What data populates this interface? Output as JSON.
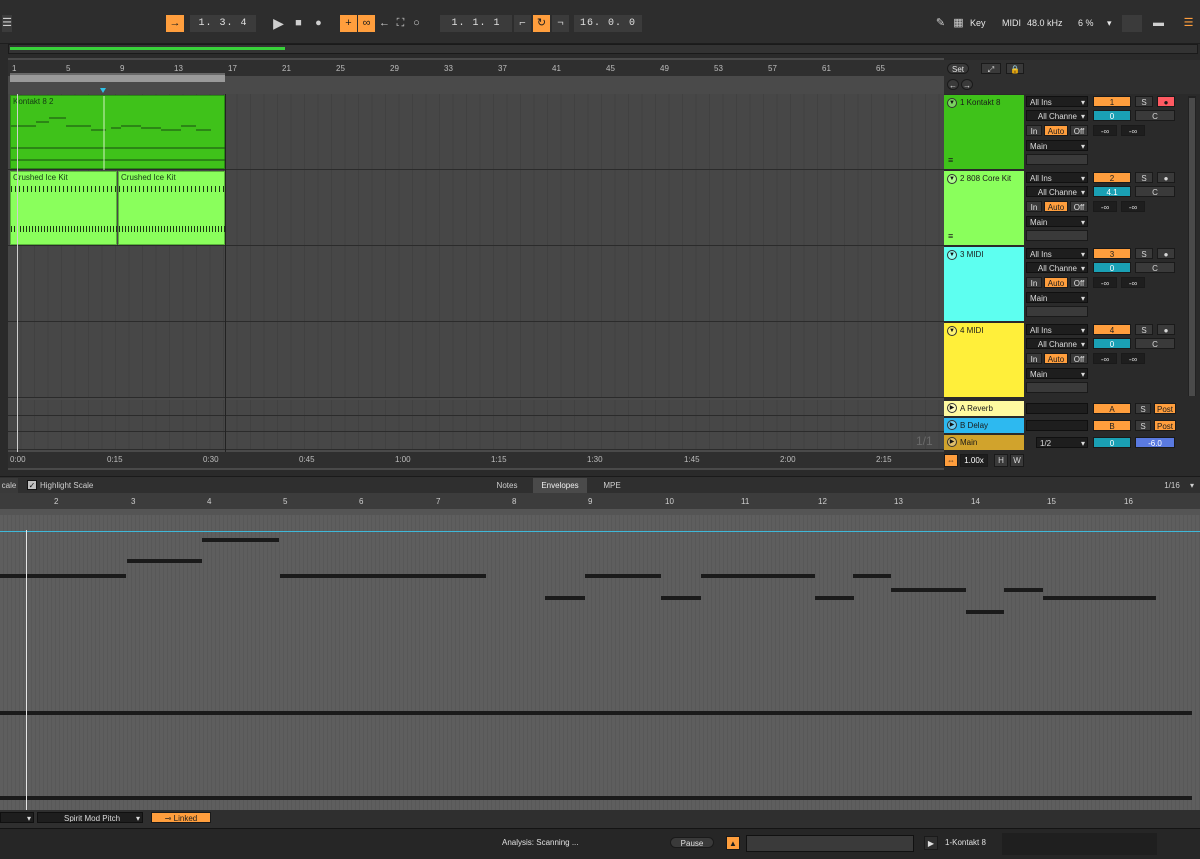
{
  "transport": {
    "arrangement_position": "1.  3.  4",
    "loop_start": "1.  1.  1",
    "loop_length": "16.  0.  0"
  },
  "topbar_right": {
    "key_label": "Key",
    "midi_label": "MIDI",
    "sample_rate": "48.0 kHz",
    "cpu_load": "6 %"
  },
  "ruler": {
    "bars": [
      "1",
      "5",
      "9",
      "13",
      "17",
      "21",
      "25",
      "29",
      "33",
      "37",
      "41",
      "45",
      "49",
      "53",
      "57",
      "61",
      "65"
    ]
  },
  "timeline": {
    "times": [
      "0:00",
      "0:15",
      "0:30",
      "0:45",
      "1:00",
      "1:15",
      "1:30",
      "1:45",
      "2:00",
      "2:15"
    ]
  },
  "clips": {
    "kontakt_clip": "Kontakt 8 2",
    "drum_clip_1": "Crushed Ice Kit",
    "drum_clip_2": "Crushed Ice Kit"
  },
  "set_button": "Set",
  "tracks": [
    {
      "name": "1 Kontakt 8",
      "color": "#3fc21a",
      "number": "1",
      "input": "All Ins",
      "channel": "All Channe",
      "monitor": [
        "In",
        "Auto",
        "Off"
      ],
      "output": "Main",
      "volume": "0",
      "pan": "C",
      "sends": [
        "-∞",
        "-∞"
      ],
      "solo": "S"
    },
    {
      "name": "2 808 Core Kit",
      "color": "#8aff5c",
      "number": "2",
      "input": "All Ins",
      "channel": "All Channe",
      "monitor": [
        "In",
        "Auto",
        "Off"
      ],
      "output": "Main",
      "volume": "4.1",
      "pan": "C",
      "sends": [
        "-∞",
        "-∞"
      ],
      "solo": "S"
    },
    {
      "name": "3 MIDI",
      "color": "#5dfff0",
      "number": "3",
      "input": "All Ins",
      "channel": "All Channe",
      "monitor": [
        "In",
        "Auto",
        "Off"
      ],
      "output": "Main",
      "volume": "0",
      "pan": "C",
      "sends": [
        "-∞",
        "-∞"
      ],
      "solo": "S"
    },
    {
      "name": "4 MIDI",
      "color": "#ffef3a",
      "number": "4",
      "input": "All Ins",
      "channel": "All Channe",
      "monitor": [
        "In",
        "Auto",
        "Off"
      ],
      "output": "Main",
      "volume": "0",
      "pan": "C",
      "sends": [
        "-∞",
        "-∞"
      ],
      "solo": "S"
    }
  ],
  "returns": [
    {
      "name": "A Reverb",
      "color": "#fffaa0",
      "letter": "A",
      "solo": "S",
      "mode": "Post"
    },
    {
      "name": "B Delay",
      "color": "#2db9f0",
      "letter": "B",
      "solo": "S",
      "mode": "Post"
    }
  ],
  "main_track": {
    "name": "Main",
    "color": "#d1a32c",
    "cue": "1/2",
    "volume": "0",
    "level": "-6.0",
    "counter": "1/1"
  },
  "zoom": {
    "value": "1.00x",
    "h_button": "H",
    "w_button": "W"
  },
  "detail": {
    "scale_label": "cale",
    "highlight_scale": "Highlight Scale",
    "tabs": [
      "Notes",
      "Envelopes",
      "MPE"
    ],
    "active_tab": "Envelopes",
    "grid": "1/16",
    "bars": [
      "2",
      "3",
      "4",
      "5",
      "6",
      "7",
      "8",
      "9",
      "10",
      "11",
      "12",
      "13",
      "14",
      "15",
      "16"
    ]
  },
  "detail_footer": {
    "envelope_param": "Spirit Mod Pitch",
    "linked_label": "Linked"
  },
  "status": {
    "analysis": "Analysis: Scanning ...",
    "pause": "Pause",
    "selected_track": "1-Kontakt 8"
  }
}
